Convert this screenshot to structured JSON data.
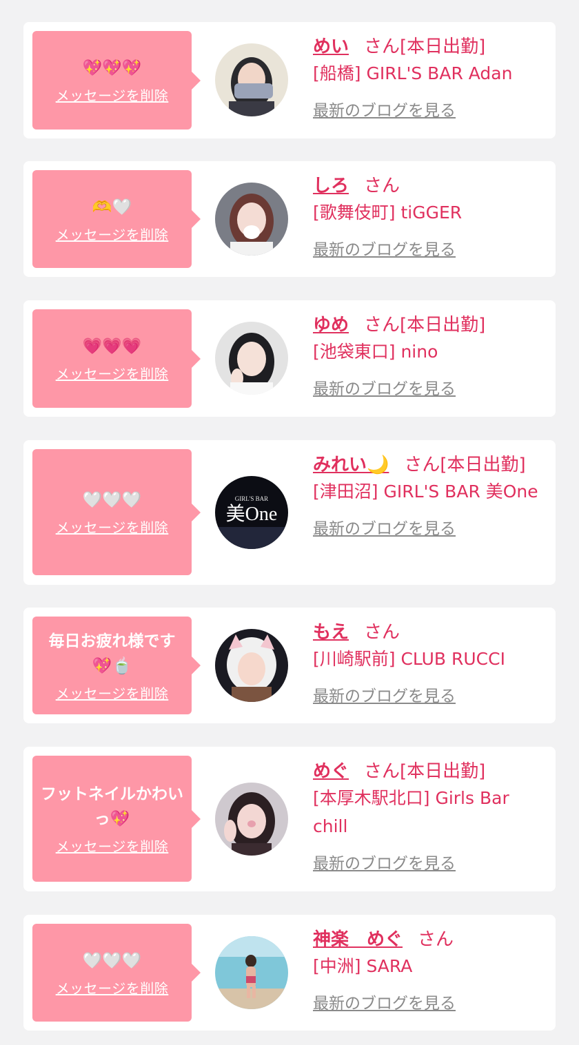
{
  "colors": {
    "page_bg": "#f2f2f3",
    "bubble": "#fe97a7",
    "accent": "#e0305e",
    "link_gray": "#8a8a8a"
  },
  "cards": [
    {
      "message": "💖💖💖",
      "delete_label": "メッセージを削除",
      "name": "めい",
      "honorific": "さん",
      "status": "[本日出勤]",
      "shop": "[船橋] GIRL'S BAR Adan",
      "blog_label": "最新のブログを見る",
      "avatar_icon": "girl-photo"
    },
    {
      "message": "🫶🤍",
      "delete_label": "メッセージを削除",
      "name": "しろ",
      "honorific": "さん",
      "status": "",
      "shop": "[歌舞伎町] tiGGER",
      "blog_label": "最新のブログを見る",
      "avatar_icon": "girl-photo"
    },
    {
      "message": "💗💗💗",
      "delete_label": "メッセージを削除",
      "name": "ゆめ",
      "honorific": "さん",
      "status": "[本日出勤]",
      "shop": "[池袋東口] nino",
      "blog_label": "最新のブログを見る",
      "avatar_icon": "girl-photo"
    },
    {
      "message": "🤍🤍🤍",
      "delete_label": "メッセージを削除",
      "name": "みれい🌙",
      "honorific": "さん",
      "status": "[本日出勤]",
      "shop": "[津田沼] GIRL'S BAR 美One",
      "blog_label": "最新のブログを見る",
      "avatar_icon": "bar-logo",
      "avatar_logo_small": "GIRL'S BAR",
      "avatar_logo_big": "美One"
    },
    {
      "message": "毎日お疲れ様です💖🍵",
      "delete_label": "メッセージを削除",
      "name": "もえ",
      "honorific": "さん",
      "status": "",
      "shop": "[川崎駅前] CLUB RUCCI",
      "blog_label": "最新のブログを見る",
      "avatar_icon": "girl-photo"
    },
    {
      "message": "フットネイルかわいっ💖",
      "delete_label": "メッセージを削除",
      "name": "めぐ",
      "honorific": "さん",
      "status": "[本日出勤]",
      "shop": "[本厚木駅北口] Girls Bar chill",
      "blog_label": "最新のブログを見る",
      "avatar_icon": "girl-photo"
    },
    {
      "message": "🤍🤍🤍",
      "delete_label": "メッセージを削除",
      "name": "神楽　めぐ",
      "honorific": "さん",
      "status": "",
      "shop": "[中洲] SARA",
      "blog_label": "最新のブログを見る",
      "avatar_icon": "beach-photo"
    }
  ]
}
